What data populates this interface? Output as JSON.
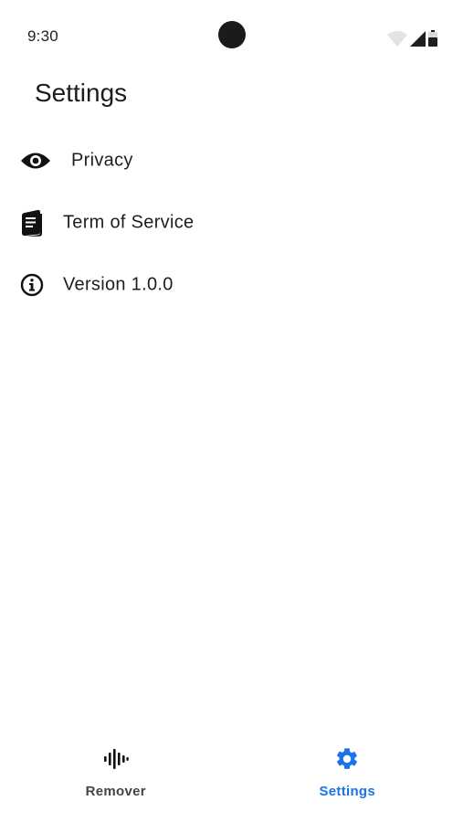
{
  "status_bar": {
    "time": "9:30",
    "icons": [
      "wifi-icon",
      "signal-icon",
      "battery-icon"
    ]
  },
  "page": {
    "title": "Settings"
  },
  "settings": {
    "items": [
      {
        "label": "Privacy",
        "icon": "eye-icon"
      },
      {
        "label": "Term of Service",
        "icon": "document-icon"
      },
      {
        "label": "Version 1.0.0",
        "icon": "info-icon"
      }
    ]
  },
  "bottom_nav": {
    "items": [
      {
        "label": "Remover",
        "icon": "audio-waveform-icon",
        "active": false
      },
      {
        "label": "Settings",
        "icon": "gear-icon",
        "active": true
      }
    ]
  },
  "colors": {
    "accent": "#1a73e8",
    "text": "#1e1e1e",
    "inactive_nav": "#444444",
    "background": "#ffffff"
  }
}
